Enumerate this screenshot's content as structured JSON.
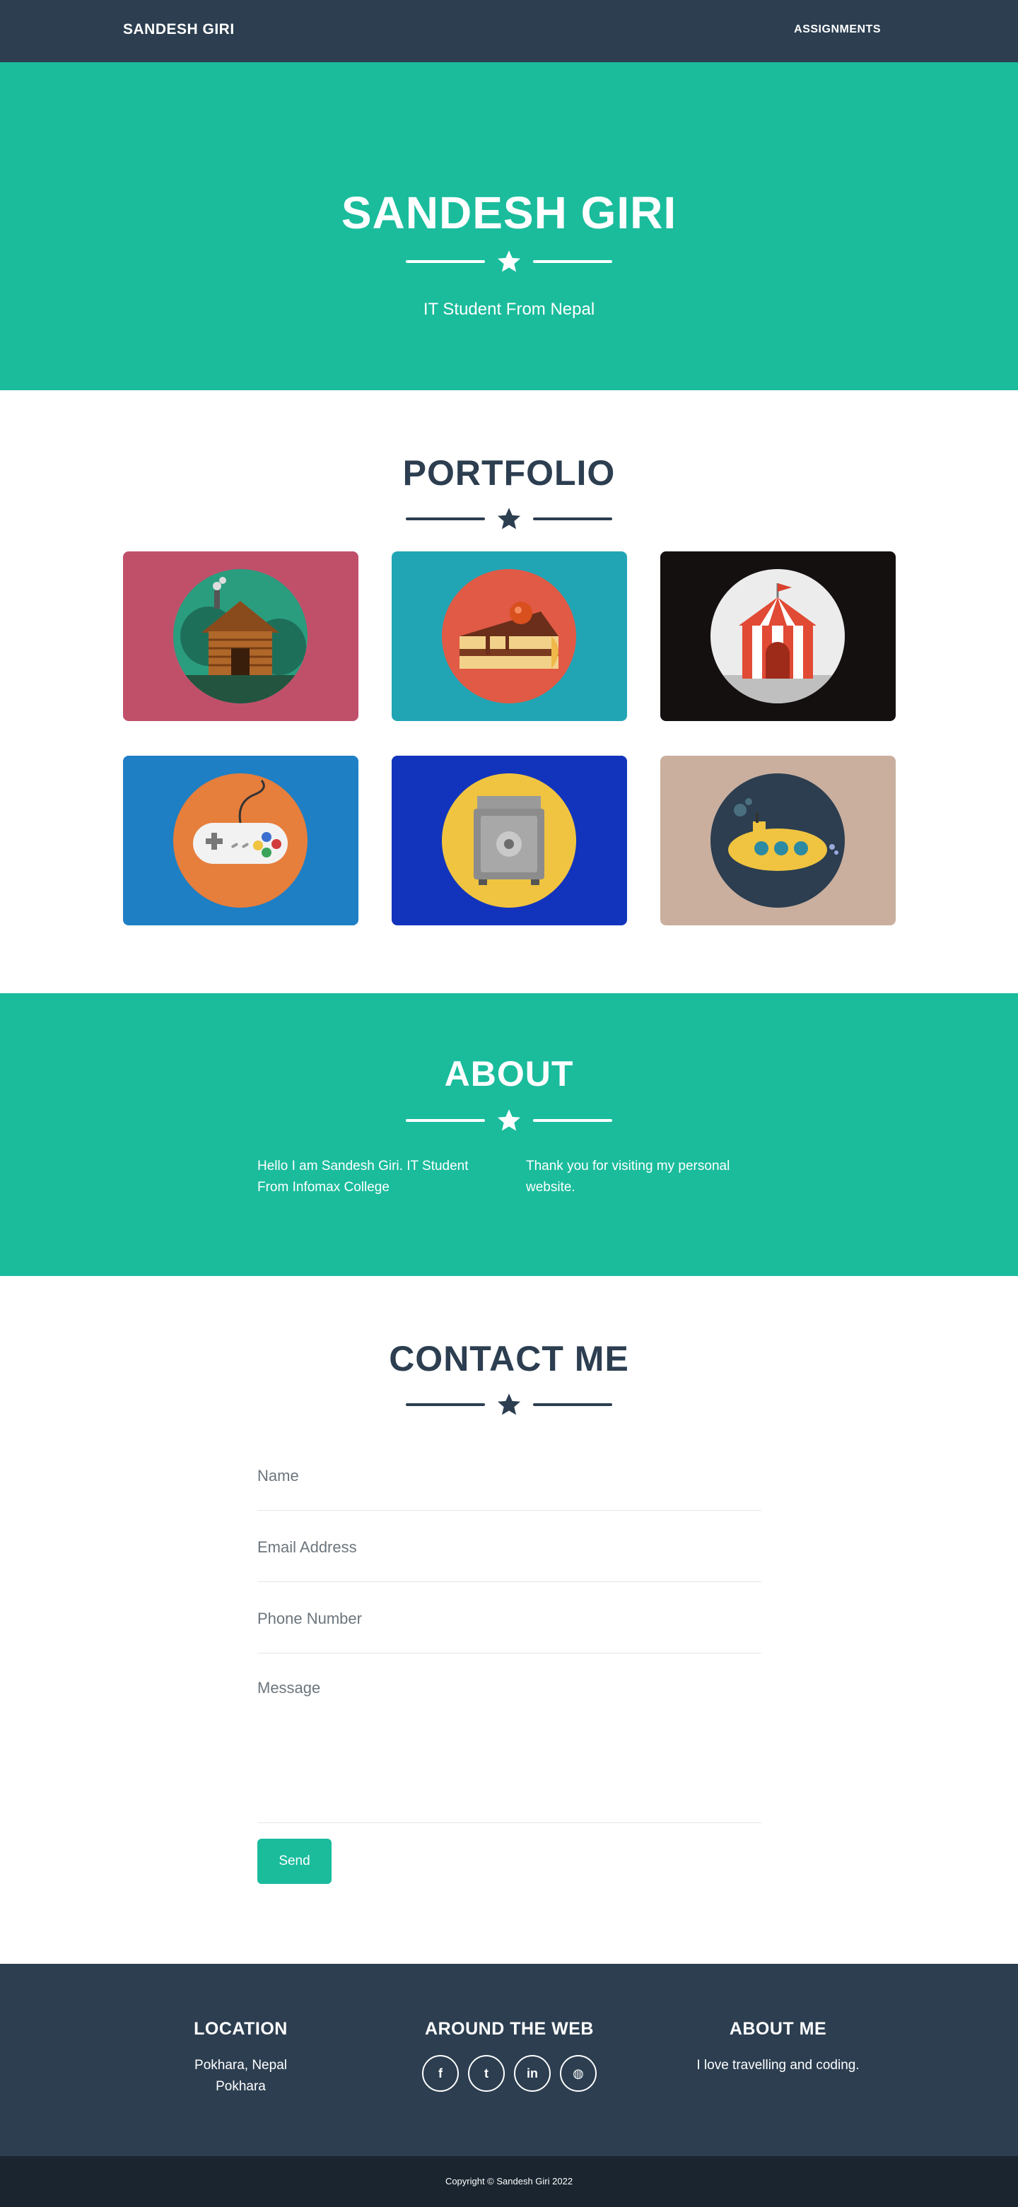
{
  "nav": {
    "brand": "SANDESH GIRI",
    "links": [
      {
        "label": "ASSIGNMENTS"
      }
    ]
  },
  "masthead": {
    "title": "SANDESH GIRI",
    "subtitle": "IT Student From Nepal",
    "divider_icon": "star-icon"
  },
  "portfolio": {
    "title": "PORTFOLIO",
    "items": [
      {
        "name": "cabin",
        "bg": "#c0506a",
        "circle": "#2a9d7f"
      },
      {
        "name": "cake",
        "bg": "#21a5b5",
        "circle": "#e05a46"
      },
      {
        "name": "circus",
        "bg": "#151010",
        "circle": "#ececec"
      },
      {
        "name": "game",
        "bg": "#1e7fc4",
        "circle": "#e67e3c"
      },
      {
        "name": "safe",
        "bg": "#1234bc",
        "circle": "#f0c440"
      },
      {
        "name": "submarine",
        "bg": "#caaf9f",
        "circle": "#2c3e50"
      }
    ]
  },
  "about": {
    "title": "ABOUT",
    "left": "Hello I am Sandesh Giri. IT Student From Infomax College",
    "right": "Thank you for visiting my personal website."
  },
  "contact": {
    "title": "CONTACT ME",
    "name_placeholder": "Name",
    "email_placeholder": "Email Address",
    "phone_placeholder": "Phone Number",
    "message_placeholder": "Message",
    "send_label": "Send"
  },
  "footer": {
    "location": {
      "title": "LOCATION",
      "line1": "Pokhara, Nepal",
      "line2": "Pokhara"
    },
    "web": {
      "title": "AROUND THE WEB",
      "icons": [
        {
          "name": "facebook-icon",
          "glyph": "f"
        },
        {
          "name": "twitter-icon",
          "glyph": "t"
        },
        {
          "name": "linkedin-icon",
          "glyph": "in"
        },
        {
          "name": "dribbble-icon",
          "glyph": "◍"
        }
      ]
    },
    "about": {
      "title": "ABOUT ME",
      "text": "I love travelling and coding."
    }
  },
  "copyright": "Copyright © Sandesh Giri 2022",
  "colors": {
    "primary": "#1abc9c",
    "secondary": "#2c3e50",
    "dark": "#1a252f"
  }
}
